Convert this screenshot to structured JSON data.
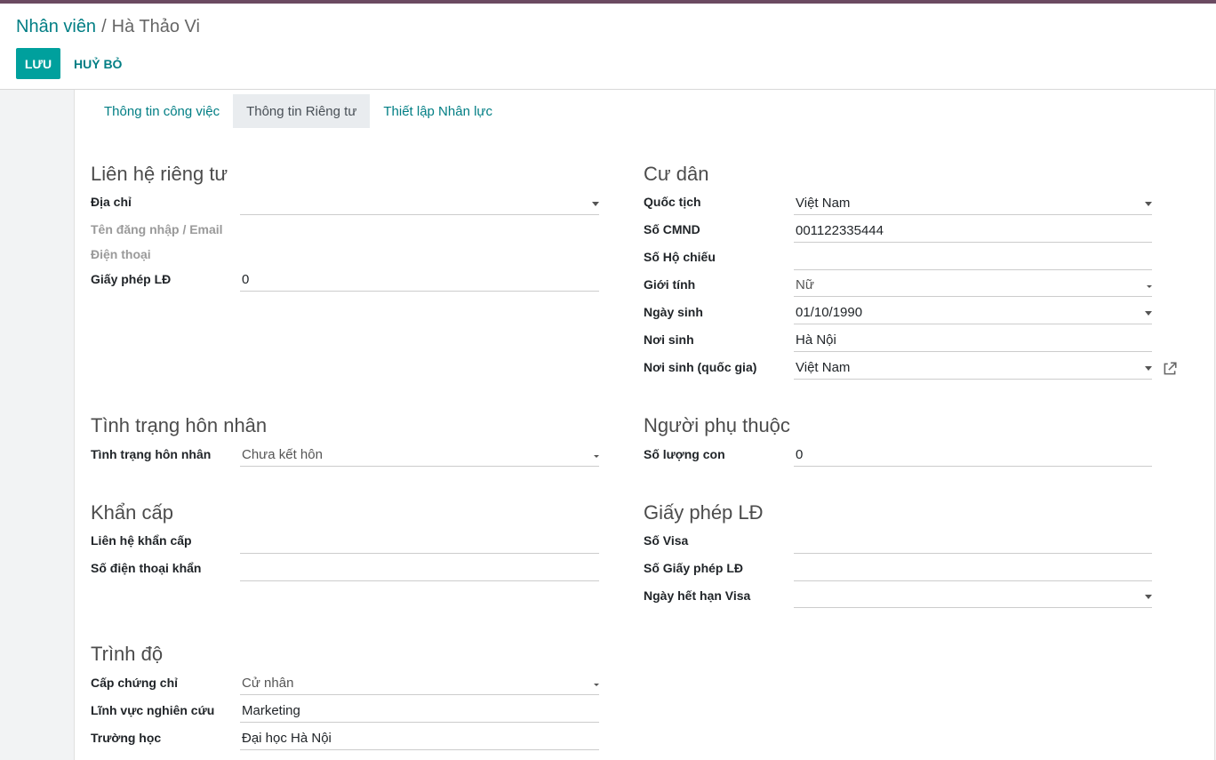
{
  "breadcrumb": {
    "parent": "Nhân viên",
    "separator": "/",
    "current": "Hà Thảo Vi"
  },
  "actions": {
    "save": "LƯU",
    "cancel": "HUỶ BỎ"
  },
  "tabs": [
    {
      "label": "Thông tin công việc",
      "active": false
    },
    {
      "label": "Thông tin Riêng tư",
      "active": true
    },
    {
      "label": "Thiết lập Nhân lực",
      "active": false
    }
  ],
  "private_contact": {
    "title": "Liên hệ riêng tư",
    "address": {
      "label": "Địa chỉ",
      "value": ""
    },
    "login_email": {
      "label": "Tên đăng nhập / Email"
    },
    "phone": {
      "label": "Điện thoại"
    },
    "work_permit": {
      "label": "Giấy phép LĐ",
      "value": "0"
    }
  },
  "citizenship": {
    "title": "Cư dân",
    "nationality": {
      "label": "Quốc tịch",
      "value": "Việt Nam"
    },
    "id_number": {
      "label": "Số CMND",
      "value": "001122335444"
    },
    "passport": {
      "label": "Số Hộ chiếu",
      "value": ""
    },
    "gender": {
      "label": "Giới tính",
      "value": "Nữ"
    },
    "birthday": {
      "label": "Ngày sinh",
      "value": "01/10/1990"
    },
    "birthplace": {
      "label": "Nơi sinh",
      "value": "Hà Nội"
    },
    "birth_country": {
      "label": "Nơi sinh (quốc gia)",
      "value": "Việt Nam"
    }
  },
  "marital": {
    "title": "Tình trạng hôn nhân",
    "status": {
      "label": "Tình trạng hôn nhân",
      "value": "Chưa kết hôn"
    }
  },
  "dependents": {
    "title": "Người phụ thuộc",
    "children": {
      "label": "Số lượng con",
      "value": "0"
    }
  },
  "emergency": {
    "title": "Khẩn cấp",
    "contact": {
      "label": "Liên hệ khẩn cấp",
      "value": ""
    },
    "phone": {
      "label": "Số điện thoại khẩn",
      "value": ""
    }
  },
  "work_permit": {
    "title": "Giấy phép LĐ",
    "visa_no": {
      "label": "Số Visa",
      "value": ""
    },
    "permit_no": {
      "label": "Số Giấy phép LĐ",
      "value": ""
    },
    "visa_expire": {
      "label": "Ngày hết hạn Visa",
      "value": ""
    }
  },
  "education": {
    "title": "Trình độ",
    "certificate": {
      "label": "Cấp chứng chỉ",
      "value": "Cử nhân"
    },
    "study_field": {
      "label": "Lĩnh vực nghiên cứu",
      "value": "Marketing"
    },
    "school": {
      "label": "Trường học",
      "value": "Đại học Hà Nội"
    }
  },
  "colors": {
    "accent": "#017e84",
    "primary_button": "#00a09d",
    "topbar": "#6b4a61"
  },
  "icons": {
    "dropdown": "caret-down-icon",
    "external": "external-link-icon"
  }
}
